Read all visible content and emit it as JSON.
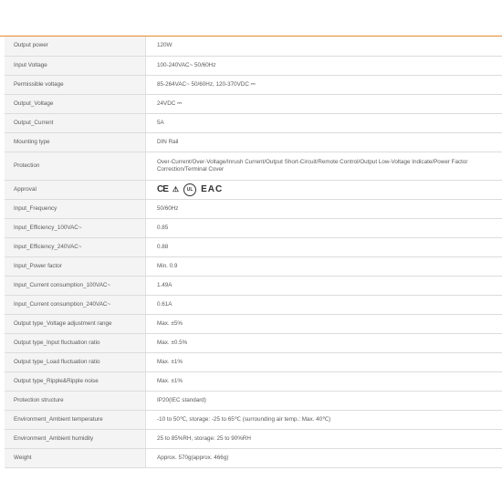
{
  "specs": [
    {
      "label": "Output power",
      "value": "120W"
    },
    {
      "label": "Input Voltage",
      "value": "100-240VAC~ 50/60Hz"
    },
    {
      "label": "Permissible voltage",
      "value": "85-264VAC~ 50/60Hz, 120-370VDC ⎓"
    },
    {
      "label": "Output_Voltage",
      "value": "24VDC ⎓"
    },
    {
      "label": "Output_Current",
      "value": "5A"
    },
    {
      "label": "Mounting type",
      "value": "DIN Rail"
    },
    {
      "label": "Protection",
      "value": "Over-Current/Over-Voltage/Inrush Current/Output Short-Circuit/Remote Control/Output Low-Voltage Indicate/Power Factor Correction/Terminal Cover"
    },
    {
      "label": "Approval",
      "value": ""
    },
    {
      "label": "Input_Frequency",
      "value": "50/60Hz"
    },
    {
      "label": "Input_Efficiency_100VAC~",
      "value": "0.85"
    },
    {
      "label": "Input_Efficiency_240VAC~",
      "value": "0.88"
    },
    {
      "label": "Input_Power factor",
      "value": "Min. 0.9"
    },
    {
      "label": "Input_Current consumption_100VAC~",
      "value": "1.49A"
    },
    {
      "label": "Input_Current consumption_240VAC~",
      "value": "0.61A"
    },
    {
      "label": "Output type_Voltage adjustment range",
      "value": "Max. ±5%"
    },
    {
      "label": "Output type_Input fluctuation ratio",
      "value": "Max. ±0.5%"
    },
    {
      "label": "Output type_Load fluctuation ratio",
      "value": "Max. ±1%"
    },
    {
      "label": "Output type_Ripple&Ripple noise",
      "value": "Max. ±1%"
    },
    {
      "label": "Protection structure",
      "value": "IP20(IEC standard)"
    },
    {
      "label": "Environment_Ambient temperature",
      "value": "-10 to 50℃, storage: -25 to 65℃ (surrounding air temp.: Max. 40℃)"
    },
    {
      "label": "Environment_Ambient humidity",
      "value": "25 to 85%RH, storage: 25 to 90%RH"
    },
    {
      "label": "Weight",
      "value": "Approx. 570g(approx. 466g)"
    }
  ],
  "approval_marks": {
    "ce": "CE",
    "triangle": "⚠",
    "ul": "UL",
    "eac": "EAC"
  }
}
